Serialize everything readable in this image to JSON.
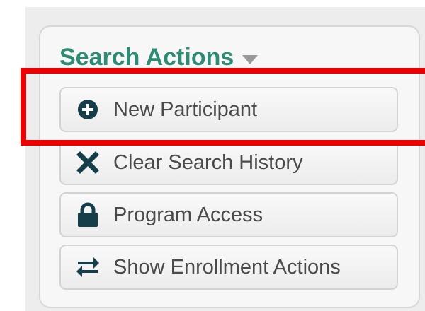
{
  "panel": {
    "title": "Search Actions",
    "title_color": "#2e8b74",
    "toggle_icon": "caret-down-icon"
  },
  "actions": [
    {
      "label": "New Participant",
      "icon": "plus-circle-icon"
    },
    {
      "label": "Clear Search History",
      "icon": "x-icon"
    },
    {
      "label": "Program Access",
      "icon": "lock-icon"
    },
    {
      "label": "Show Enrollment Actions",
      "icon": "exchange-arrows-icon"
    }
  ],
  "colors": {
    "icon": "#163e4a",
    "highlight": "#ee0000"
  }
}
